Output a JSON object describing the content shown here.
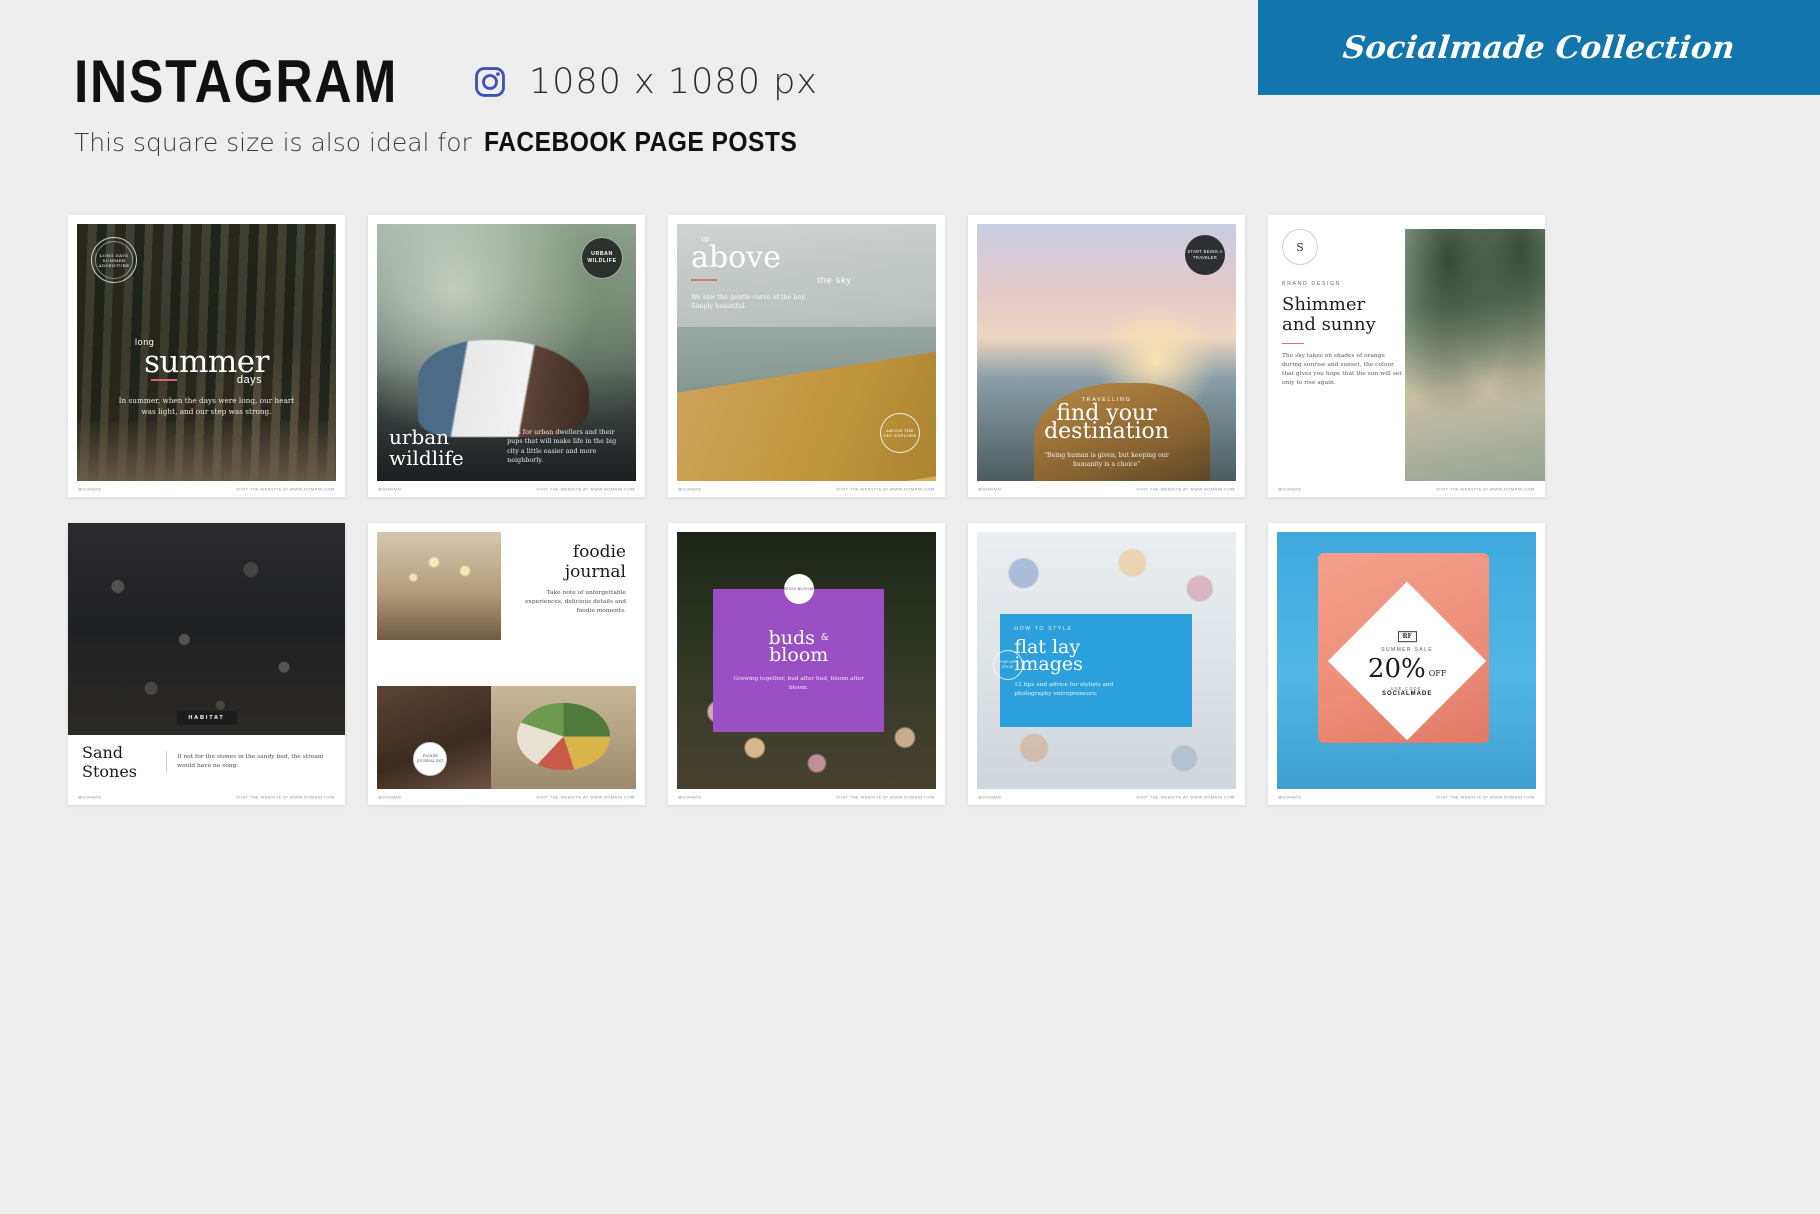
{
  "header": {
    "title": "INSTAGRAM",
    "icon": "instagram-icon",
    "dimensions": "1080 x 1080 px",
    "subtitle_light": "This square size is also ideal for",
    "subtitle_bold": "FACEBOOK PAGE POSTS",
    "badge_text": "Socialmade Collection",
    "badge_color": "#1275ab"
  },
  "footer_defaults": {
    "left": "@DOMAIN",
    "right": "VISIT THE WEBSITE AT WWW.DOMAIN.COM"
  },
  "cards": [
    {
      "id": "long-summer",
      "stamp": "LONG DAYS SUMMER ADVENTURE",
      "kicker": "long",
      "title": "summer",
      "sub": "days",
      "body": "In summer, when the days were long, our heart was light, and our step was strong.",
      "foot_left": "@DOMAIN",
      "foot_right": "VISIT THE WEBSITE AT WWW.DOMAIN.COM"
    },
    {
      "id": "urban-wildlife",
      "badge_line1": "URBAN",
      "badge_line2": "WILDLIFE",
      "title_line1": "urban",
      "title_line2": "wildlife",
      "body": "Tips for urban dwellers and their pups that will make life in the big city a little easier and more neighborly.",
      "foot_left": "@DOMAIN",
      "foot_right": "VISIT THE WEBSITE AT WWW.DOMAIN.COM"
    },
    {
      "id": "up-above",
      "kicker": "up",
      "title": "above",
      "sub": "the sky",
      "body": "We saw the gentle curve of the bay. Simply beautiful.",
      "seal": "ABOVE THE SKY EXPLORE",
      "foot_left": "@DOMAIN",
      "foot_right": "VISIT THE WEBSITE AT WWW.DOMAIN.COM"
    },
    {
      "id": "find-your-destination",
      "badge": "START BEING A TRAVELER",
      "kicker": "TRAVELLING",
      "title_line1": "find your",
      "title_line2": "destination",
      "body": "\"Being human is given, but keeping our humanity is a choice\"",
      "foot_left": "@DOMAIN",
      "foot_right": "VISIT THE WEBSITE AT WWW.DOMAIN.COM"
    },
    {
      "id": "shimmer-and-sunny",
      "seal": "S",
      "kicker": "BRAND DESIGN",
      "title_line1": "Shimmer",
      "title_line2": "and sunny",
      "body": "The sky takes on shades of orange during sunrise and sunset, the colour that gives you hope that the sun will set only to rise again.",
      "foot_left": "@DOMAIN",
      "foot_right": "VISIT THE WEBSITE AT WWW.DOMAIN.COM"
    },
    {
      "id": "sand-stones",
      "label": "HABITAT",
      "title": "Sand Stones",
      "body": "If not for the stones in the sandy bed, the stream would have no song.",
      "foot_left": "@DOMAIN",
      "foot_right": "VISIT THE WEBSITE AT WWW.DOMAIN.COM"
    },
    {
      "id": "foodie-journal",
      "title_line1": "foodie",
      "title_line2": "journal",
      "body": "Take note of unforgettable experiences, delicious details and foodie moments.",
      "seal": "FOODIE JOURNAL EST",
      "foot_left": "@DOMAIN",
      "foot_right": "VISIT THE WEBSITE AT WWW.DOMAIN.COM"
    },
    {
      "id": "buds-and-bloom",
      "seal": "BUDS BLOOM",
      "title_line1": "buds",
      "amp": "&",
      "title_line2": "bloom",
      "body": "Growing together, bud after bud, bloom after bloom.",
      "foot_left": "@DOMAIN",
      "foot_right": "VISIT THE WEBSITE AT WWW.DOMAIN.COM"
    },
    {
      "id": "flat-lay-images",
      "seal": "FLAT LAY STYLE",
      "kicker": "HOW TO STYLE",
      "title_line1": "flat lay",
      "title_line2": "images",
      "body": "12 tips and advice for stylists and photography entrepreneurs.",
      "foot_left": "@DOMAIN",
      "foot_right": "VISIT THE WEBSITE AT WWW.DOMAIN.COM"
    },
    {
      "id": "summer-sale",
      "logo": "RF",
      "kicker": "SUMMER SALE",
      "percent": "20%",
      "off": "OFF",
      "code_label": "USE CODE:",
      "code": "SOCIALMADE",
      "foot_left": "@DOMAIN",
      "foot_right": "VISIT THE WEBSITE AT WWW.DOMAIN.COM"
    }
  ]
}
